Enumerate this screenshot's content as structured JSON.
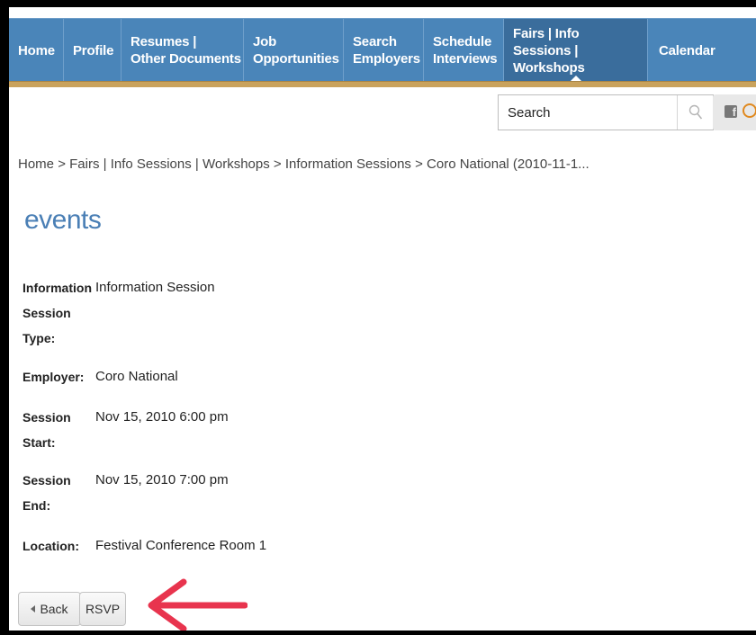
{
  "nav": {
    "items": [
      {
        "label": "Home"
      },
      {
        "label": "Profile"
      },
      {
        "label_line1": "Resumes |",
        "label_line2": "Other Documents"
      },
      {
        "label_line1": "Job",
        "label_line2": "Opportunities"
      },
      {
        "label_line1": "Search",
        "label_line2": "Employers"
      },
      {
        "label_line1": "Schedule",
        "label_line2": "Interviews"
      },
      {
        "label_line1": "Fairs | Info",
        "label_line2": "Sessions | Workshops"
      },
      {
        "label": "Calendar"
      }
    ]
  },
  "search": {
    "placeholder": "Search",
    "icon": "magnifier-icon"
  },
  "social": {
    "facebook_icon": "facebook-icon",
    "facebook_glyph": "f"
  },
  "breadcrumb": {
    "home": "Home",
    "sep": ">",
    "fairs": "Fairs | Info Sessions | Workshops",
    "info": "Information Sessions",
    "current": "Coro National (2010-11-1..."
  },
  "page": {
    "title": "events"
  },
  "details": {
    "type_label_1": "Information",
    "type_label_2": "Session",
    "type_label_3": "Type:",
    "type_value": "Information Session",
    "employer_label": "Employer:",
    "employer_value": "Coro National",
    "start_label_1": "Session",
    "start_label_2": "Start:",
    "start_value": "Nov 15, 2010 6:00 pm",
    "end_label_1": "Session",
    "end_label_2": "End:",
    "end_value": "Nov 15, 2010 7:00 pm",
    "location_label": "Location:",
    "location_value": "Festival Conference Room 1"
  },
  "buttons": {
    "back": "Back",
    "rsvp": "RSVP"
  },
  "colors": {
    "nav_bg": "#4a85b9",
    "nav_active": "#3a6d9c",
    "gold_bar": "#c9a25c",
    "title": "#4a7fb5",
    "annotation_arrow": "#e8344e"
  }
}
